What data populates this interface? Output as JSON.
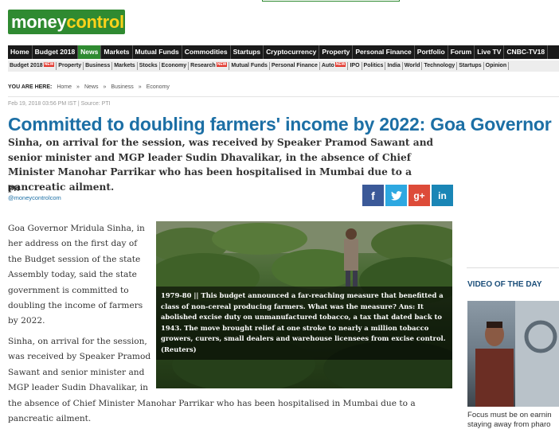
{
  "logo": {
    "part1": "money",
    "part2": "control"
  },
  "nav_primary": [
    "Home",
    "Budget 2018",
    "News",
    "Markets",
    "Mutual Funds",
    "Commodities",
    "Startups",
    "Cryptocurrency",
    "Property",
    "Personal Finance",
    "Portfolio",
    "Forum",
    "Live TV",
    "CNBC-TV18"
  ],
  "nav_primary_active": "News",
  "nav_secondary": [
    {
      "label": "Budget 2018",
      "badge": "NEW"
    },
    {
      "label": "Property",
      "badge": ""
    },
    {
      "label": "Business",
      "badge": ""
    },
    {
      "label": "Markets",
      "badge": ""
    },
    {
      "label": "Stocks",
      "badge": ""
    },
    {
      "label": "Economy",
      "badge": ""
    },
    {
      "label": "Research",
      "badge": "NEW"
    },
    {
      "label": "Mutual Funds",
      "badge": ""
    },
    {
      "label": "Personal Finance",
      "badge": ""
    },
    {
      "label": "Auto",
      "badge": "NEW"
    },
    {
      "label": "IPO",
      "badge": ""
    },
    {
      "label": "Politics",
      "badge": ""
    },
    {
      "label": "India",
      "badge": ""
    },
    {
      "label": "World",
      "badge": ""
    },
    {
      "label": "Technology",
      "badge": ""
    },
    {
      "label": "Startups",
      "badge": ""
    },
    {
      "label": "Opinion",
      "badge": ""
    }
  ],
  "breadcrumb": {
    "label": "YOU ARE HERE:",
    "items": [
      "Home",
      "»",
      "News",
      "»",
      "Business",
      "»",
      "Economy"
    ]
  },
  "article": {
    "dateline": "Feb 19, 2018 03:56 PM IST | Source: PTI",
    "headline": "Committed to doubling farmers' income by 2022: Goa Governor",
    "summary": "Sinha, on arrival for the session, was received by Speaker Pramod Sawant and senior minister and MGP leader Sudin Dhavalikar, in the absence of Chief Minister Manohar Parrikar who has been hospitalised in Mumbai due to a pancreatic ailment.",
    "author": "PTI",
    "author_handle": "@moneycontrolcom",
    "para1": "Goa Governor Mridula Sinha, in her address on the first day of the Budget session of the state Assembly today, said the state government is committed to doubling the income of farmers by 2022.",
    "para2_start": "Sinha, on arrival for the session, was received by Speaker Pramod Sawant and senior minister and MGP leader Sudin Dhavalikar, in",
    "para2_end": "the absence of Chief Minister Manohar Parrikar who has been hospitalised in Mumbai due to a pancreatic ailment.",
    "photo_caption": "1979-80 || This budget announced a far-reaching measure that benefitted a class of non-cereal producing farmers. What was the measure? Ans: It abolished excise duty on unmanufactured tobacco, a tax that dated back to 1943. The move brought relief at one stroke to nearly a million tobacco growers, curers, small dealers and warehouse licensees from excise control. (Reuters)"
  },
  "social": {
    "facebook": "f",
    "twitter": "t",
    "googleplus": "g+",
    "linkedin": "in"
  },
  "sidebar": {
    "video_title": "VIDEO OF THE DAY",
    "video_caption_line1": "Focus must be on earnin",
    "video_caption_line2": "staying away from pharo"
  },
  "colors": {
    "brand_green": "#2f8a31",
    "headline_blue": "#1c6fa5",
    "nav_dark": "#1a1a1a",
    "badge_red": "#e2362c"
  }
}
